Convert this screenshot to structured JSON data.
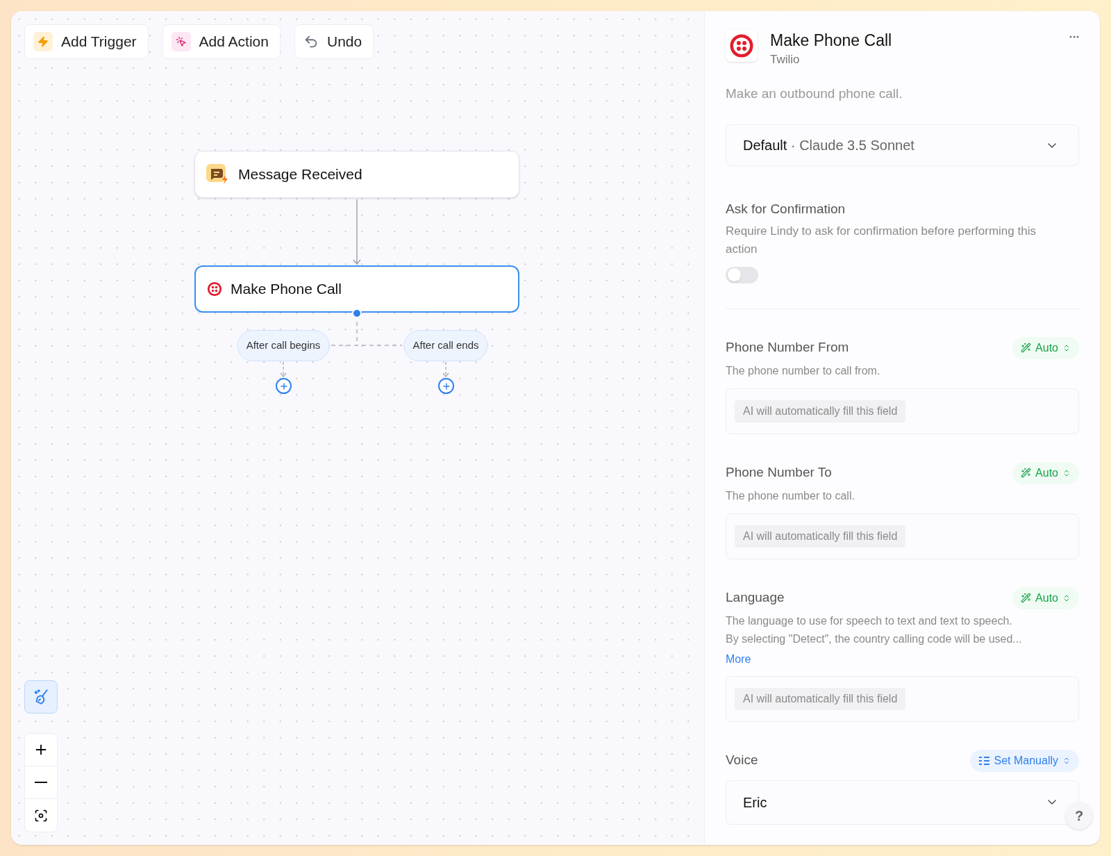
{
  "toolbar": [
    {
      "kind": "trigger",
      "label": "Add Trigger"
    },
    {
      "kind": "action",
      "label": "Add Action"
    },
    {
      "kind": "undo",
      "label": "Undo"
    }
  ],
  "nodes": [
    {
      "kind": "message",
      "label": "Message Received",
      "selected": false
    },
    {
      "kind": "twilio",
      "label": "Make Phone Call",
      "selected": true
    }
  ],
  "branches": [
    {
      "label": "After call begins"
    },
    {
      "label": "After call ends"
    }
  ],
  "panel": {
    "title": "Make Phone Call",
    "subtitle": "Twilio",
    "description": "Make an outbound phone call.",
    "model": {
      "name": "Default",
      "separator": "·",
      "value": "Claude 3.5 Sonnet"
    },
    "confirmation": {
      "title": "Ask for Confirmation",
      "description": "Require Lindy to ask for confirmation before performing this action",
      "on": false
    },
    "fields": [
      {
        "kind": "text",
        "label": "Phone Number From",
        "mode": {
          "kind": "auto",
          "label": "Auto"
        },
        "description": "The phone number to call from.",
        "note": "AI will automatically fill this field"
      },
      {
        "kind": "text",
        "label": "Phone Number To",
        "mode": {
          "kind": "auto",
          "label": "Auto"
        },
        "description": "The phone number to call.",
        "note": "AI will automatically fill this field"
      },
      {
        "kind": "text",
        "label": "Language",
        "mode": {
          "kind": "auto",
          "label": "Auto"
        },
        "description": "The language to use for speech to text and text to speech.",
        "description_more": "By selecting \"Detect\", the country calling code will be used...",
        "more": "More",
        "note": "AI will automatically fill this field"
      },
      {
        "kind": "select",
        "label": "Voice",
        "mode": {
          "kind": "manual",
          "label": "Set Manually"
        },
        "value": "Eric"
      }
    ]
  },
  "help": "?"
}
